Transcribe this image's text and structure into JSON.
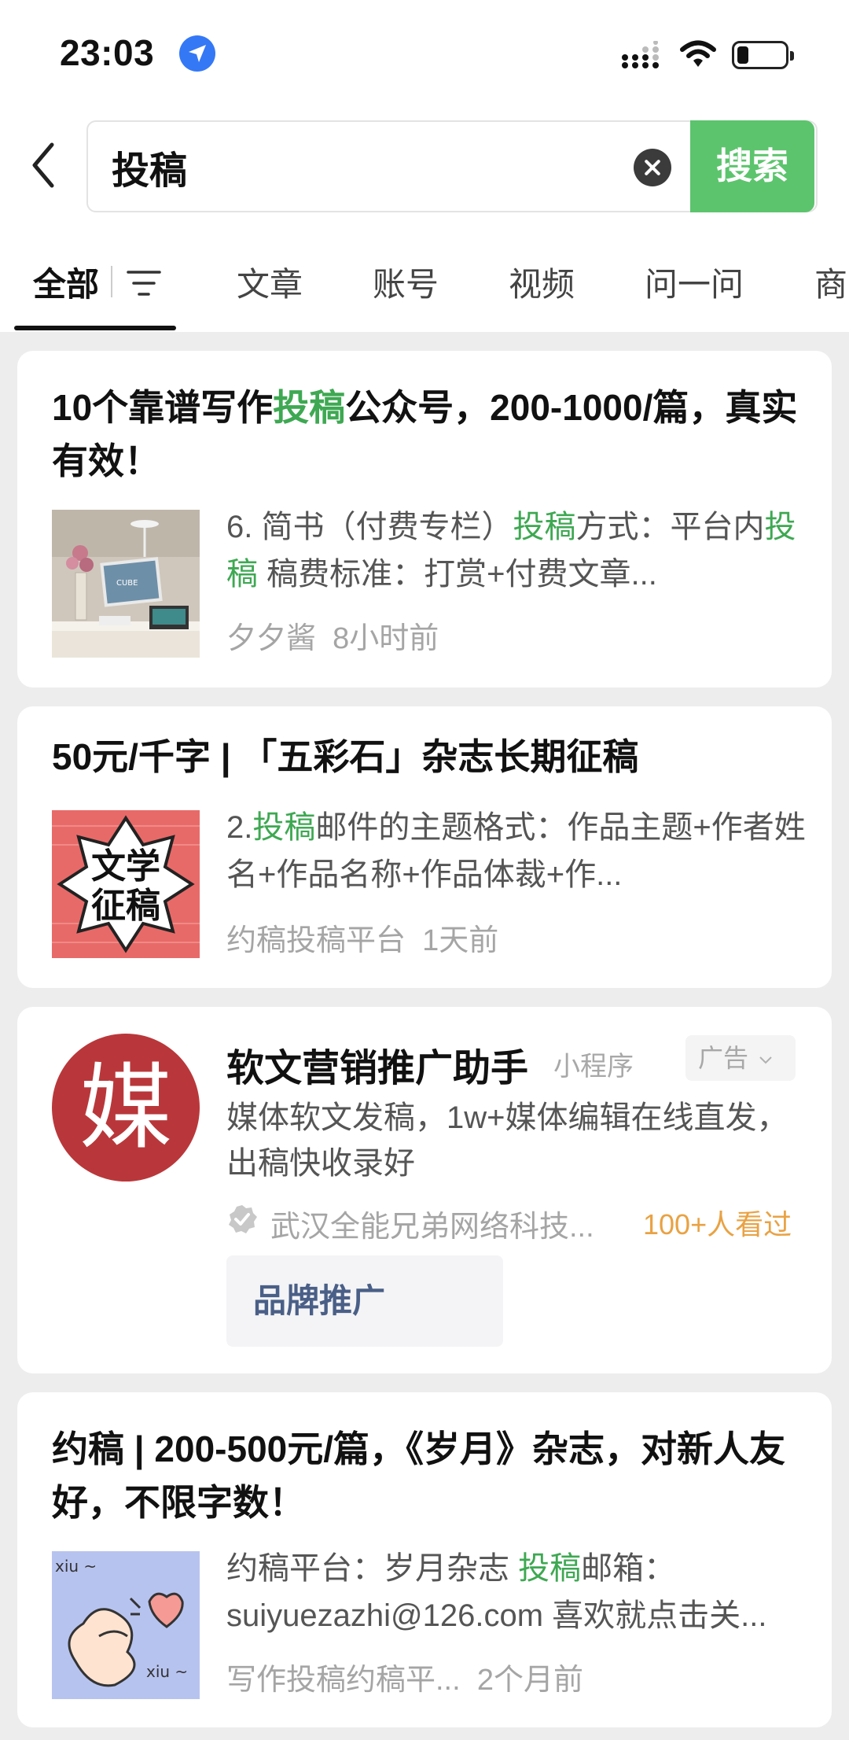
{
  "status_bar": {
    "time": "23:03"
  },
  "search": {
    "query": "投稿",
    "button_label": "搜索"
  },
  "tabs": [
    {
      "label": "全部"
    },
    {
      "label": "文章"
    },
    {
      "label": "账号"
    },
    {
      "label": "视频"
    },
    {
      "label": "问一问"
    },
    {
      "label": "商"
    }
  ],
  "results": [
    {
      "title_parts": [
        "10个靠谱写作",
        "投稿",
        "公众号，200-1000/篇，真实有效！"
      ],
      "snippet_parts": [
        "6. 简书（付费专栏）",
        "投稿",
        "方式：平台内",
        "投稿",
        " 稿费标准：打赏+付费文章..."
      ],
      "author": "夕夕酱",
      "time": "8小时前",
      "thumb_text": "CUBE"
    },
    {
      "title": "50元/千字 | 「五彩石」杂志长期征稿",
      "snippet_parts": [
        "2.",
        "投稿",
        "邮件的主题格式：作品主题+作者姓名+作品名称+作品体裁+作..."
      ],
      "author": "约稿投稿平台",
      "time": "1天前",
      "thumb_line1": "文学",
      "thumb_line2": "征稿"
    },
    {
      "title_parts": [
        "约稿 | 200-500元/篇，《岁月》杂志，对新人友好，不限字数！"
      ],
      "snippet_parts": [
        "约稿平台：岁月杂志 ",
        "投稿",
        "邮箱：suiyuezazhi@126.com 喜欢就点击关..."
      ],
      "author": "写作投稿约稿平...",
      "time": "2个月前",
      "thumb_text1": "xiu ~",
      "thumb_text2": "xiu ~"
    }
  ],
  "ad": {
    "avatar_char": "媒",
    "name": "软文营销推广助手",
    "type": "小程序",
    "tag": "广告",
    "desc": "媒体软文发稿，1w+媒体编辑在线直发，出稿快收录好",
    "company": "武汉全能兄弟网络科技...",
    "views": "100+人看过",
    "button": "品牌推广"
  },
  "colors": {
    "accent_green": "#5cc46d",
    "highlight_green": "#3ea852",
    "ad_red": "#b9373a",
    "views_orange": "#e9a243"
  }
}
